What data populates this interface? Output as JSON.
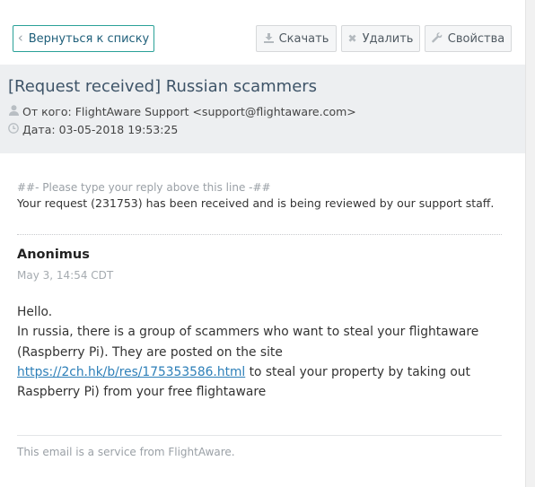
{
  "toolbar": {
    "back_label": "Вернуться к списку",
    "download_label": "Скачать",
    "delete_label": "Удалить",
    "properties_label": "Свойства"
  },
  "header": {
    "subject": "[Request received] Russian scammers",
    "from_label": "От кого:",
    "from_value": "FlightAware Support <support@flightaware.com>",
    "date_label": "Дата:",
    "date_value": "03-05-2018 19:53:25"
  },
  "message": {
    "reply_line": "##- Please type your reply above this line -##",
    "received_text": "Your request (231753) has been received and is being reviewed by our support staff.",
    "author": "Anonimus",
    "timestamp": "May 3, 14:54 CDT",
    "greeting": "Hello.",
    "body_part1": "In russia, there is a group of scammers who want to steal your flightaware (Raspberry Pi). They are posted on the site",
    "link_text": "https://2ch.hk/b/res/175353586.html",
    "body_part2": " to steal your property by taking out Raspberry Pi) from your free flightaware",
    "footer": "This email is a service from FlightAware."
  },
  "icons": {
    "back": "chevron-left-icon",
    "download": "download-icon",
    "delete": "close-icon",
    "properties": "wrench-icon",
    "from": "user-icon",
    "date": "clock-icon"
  }
}
